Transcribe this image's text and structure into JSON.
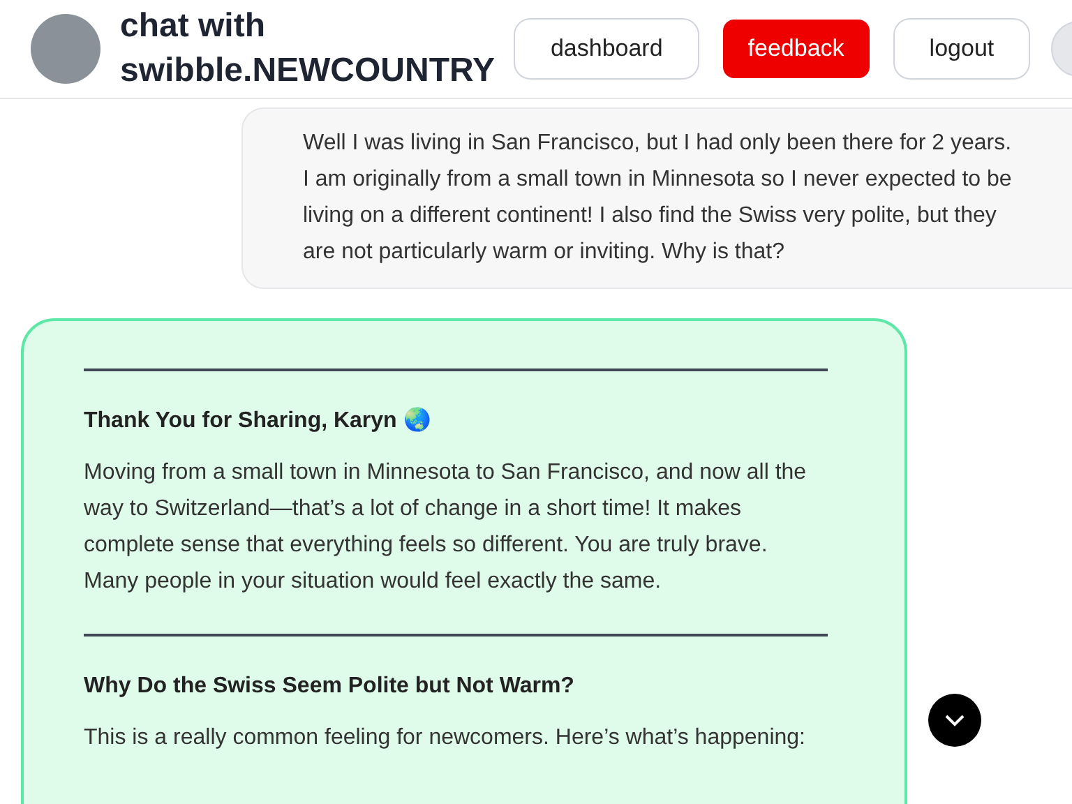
{
  "header": {
    "title": "chat with swibble.NEWCOUNTRY",
    "buttons": [
      {
        "label": "dashboard",
        "kind": "plain"
      },
      {
        "label": "feedback",
        "kind": "primary"
      },
      {
        "label": "logout",
        "kind": "plain"
      }
    ]
  },
  "messages": [
    {
      "kind": "user",
      "paragraphs": [
        "Well I was living in San Francisco, but I had only been there for 2 years. I am originally from a small town in Minnesota so I never expected to be living on a different continent! I also find the Swiss very polite, but they are not particularly warm or inviting. Why is that?"
      ]
    },
    {
      "kind": "assistant",
      "blocks": [
        {
          "kind": "rule"
        },
        {
          "kind": "heading",
          "text": "Thank You for Sharing, Karyn 🌏"
        },
        {
          "kind": "paragraph",
          "text": "Moving from a small town in Minnesota to San Francisco, and now all the way to Switzerland—that’s a lot of change in a short time! It makes complete sense that everything feels so different. You are truly brave. Many people in your situation would feel exactly the same."
        },
        {
          "kind": "rule"
        },
        {
          "kind": "heading",
          "text": "Why Do the Swiss Seem Polite but Not Warm?"
        },
        {
          "kind": "paragraph",
          "text": "This is a really common feeling for newcomers. Here’s what’s happening:"
        }
      ]
    }
  ]
}
